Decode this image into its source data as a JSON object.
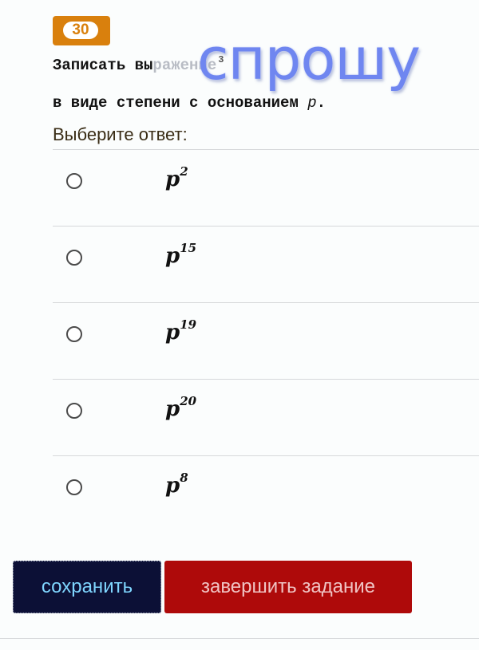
{
  "question": {
    "number": "30",
    "line1_visible": "Записать вы",
    "line1_obscured": "ражение",
    "line1_superscript": "3",
    "line2": "в виде степени с основанием ",
    "line2_var": "p",
    "line2_end": ".",
    "prompt": "Выберите ответ:"
  },
  "watermark": "спрошу",
  "options": [
    {
      "base": "p",
      "exponent": "2"
    },
    {
      "base": "p",
      "exponent": "15"
    },
    {
      "base": "p",
      "exponent": "19"
    },
    {
      "base": "p",
      "exponent": "20"
    },
    {
      "base": "p",
      "exponent": "8"
    }
  ],
  "buttons": {
    "save": "сохранить",
    "finish": "завершить задание"
  },
  "colors": {
    "badge": "#d9800d",
    "save_button": "#0c1036",
    "finish_button": "#ae0a0a",
    "watermark": "#6f86f0"
  }
}
